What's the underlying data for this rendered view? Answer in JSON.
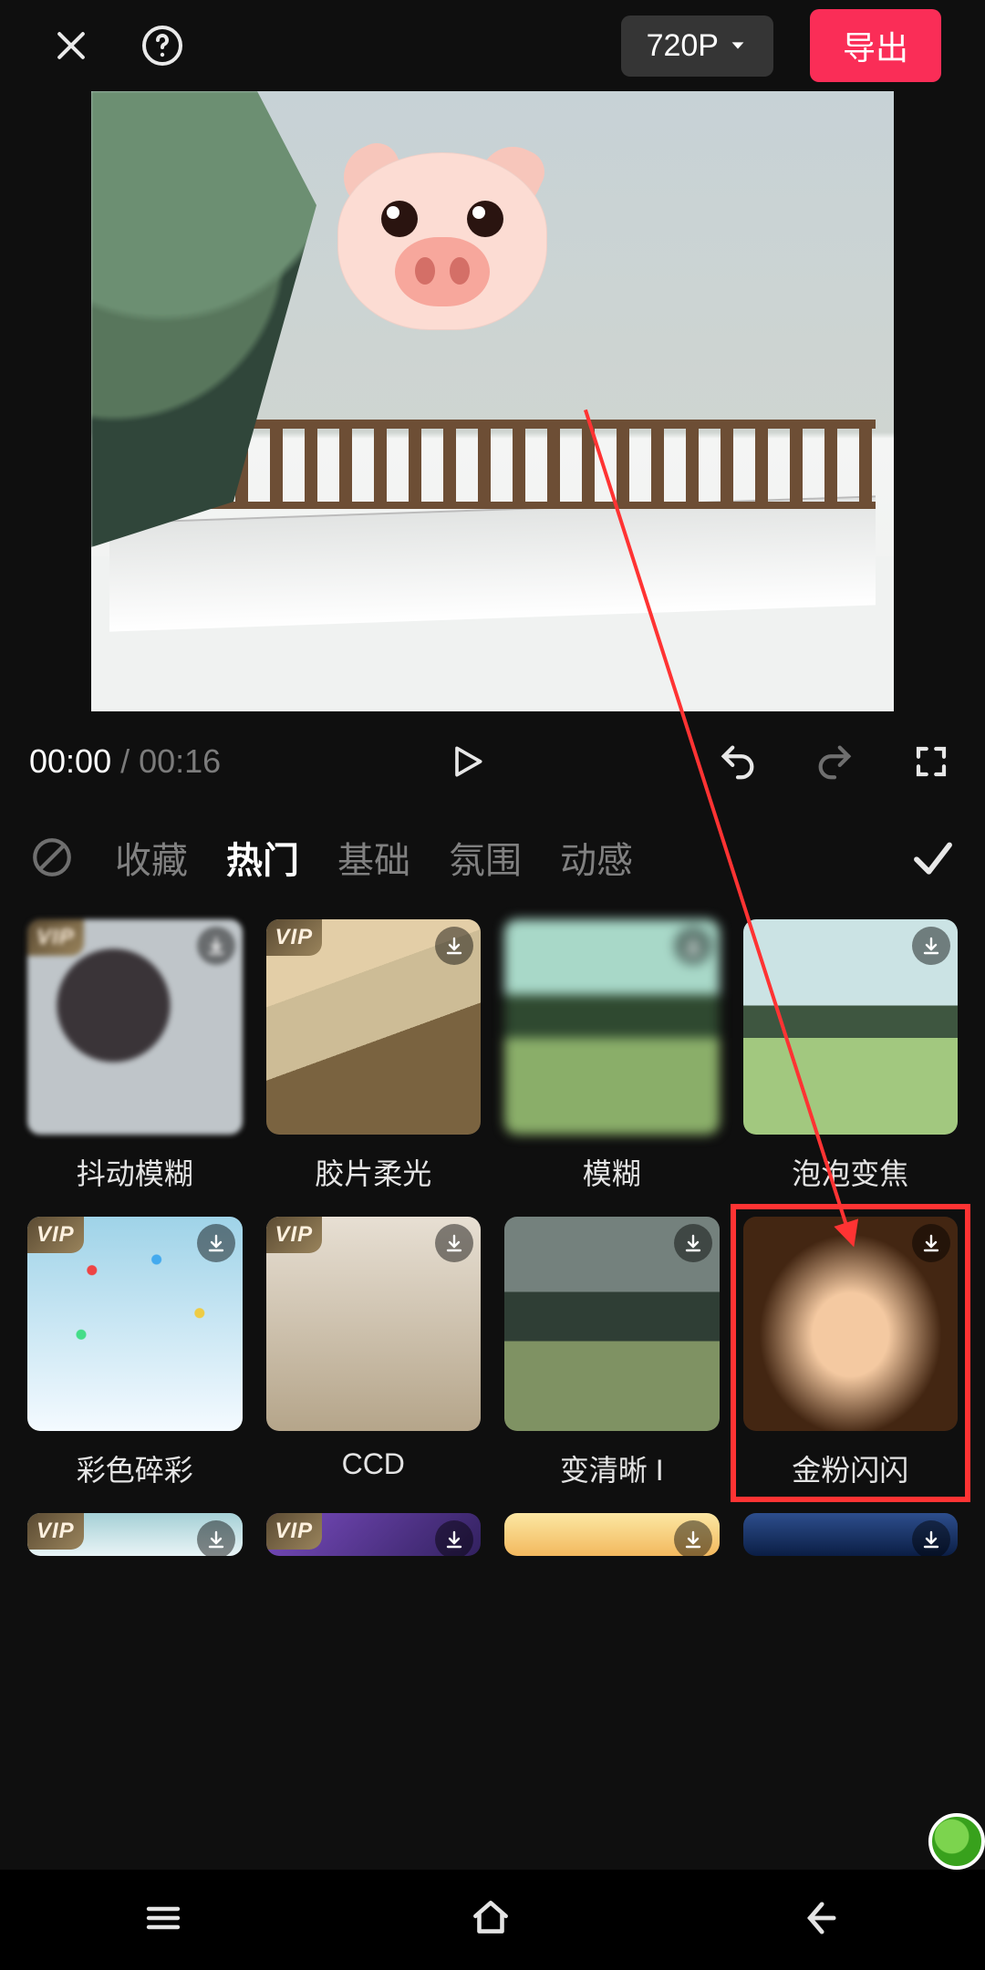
{
  "header": {
    "resolution_label": "720P",
    "export_label": "导出"
  },
  "player": {
    "current_time": "00:00",
    "separator": " / ",
    "total_time": "00:16"
  },
  "categories": {
    "items": [
      {
        "label": "收藏",
        "active": false
      },
      {
        "label": "热门",
        "active": true
      },
      {
        "label": "基础",
        "active": false
      },
      {
        "label": "氛围",
        "active": false
      },
      {
        "label": "动感",
        "active": false
      }
    ]
  },
  "effects": {
    "row1": [
      {
        "name": "抖动模糊",
        "vip": true,
        "thumb_class": "t1",
        "vip_text": "VIP"
      },
      {
        "name": "胶片柔光",
        "vip": true,
        "thumb_class": "t2",
        "vip_text": "VIP"
      },
      {
        "name": "模糊",
        "vip": false,
        "thumb_class": "t3",
        "vip_text": ""
      },
      {
        "name": "泡泡变焦",
        "vip": false,
        "thumb_class": "t4",
        "vip_text": ""
      }
    ],
    "row2": [
      {
        "name": "彩色碎彩",
        "vip": true,
        "thumb_class": "t5",
        "vip_text": "VIP"
      },
      {
        "name": "CCD",
        "vip": true,
        "thumb_class": "t6",
        "vip_text": "VIP"
      },
      {
        "name": "变清晰 I",
        "vip": false,
        "thumb_class": "t7",
        "vip_text": ""
      },
      {
        "name": "金粉闪闪",
        "vip": false,
        "thumb_class": "t8",
        "vip_text": "",
        "highlighted": true
      }
    ],
    "row3": [
      {
        "vip": true,
        "thumb_class": "t9",
        "vip_text": "VIP"
      },
      {
        "vip": true,
        "thumb_class": "t10",
        "vip_text": "VIP"
      },
      {
        "vip": false,
        "thumb_class": "t11",
        "vip_text": ""
      },
      {
        "vip": false,
        "thumb_class": "t12",
        "vip_text": ""
      }
    ]
  },
  "annotation": {
    "highlight_target": "金粉闪闪"
  }
}
